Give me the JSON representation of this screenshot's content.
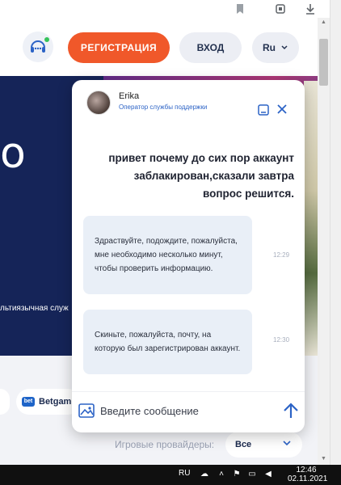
{
  "browser": {
    "icons": [
      "bookmark-icon",
      "extensions-icon",
      "download-icon"
    ]
  },
  "header": {
    "register_label": "РЕГИСТРАЦИЯ",
    "login_label": "ВХОД",
    "language_label": "Ru",
    "accent_color": "#f0582a"
  },
  "hero": {
    "big_text": "о",
    "small_text": "льтиязычная служ"
  },
  "providers": {
    "chip_name": "Betgam",
    "chip_logo_text": "bet",
    "filter_label": "Игровые провайдеры:",
    "filter_value": "Все"
  },
  "chat": {
    "agent": {
      "name": "Erika",
      "role": "Оператор службы поддержки"
    },
    "messages": [
      {
        "from": "user",
        "text": "привет почему до сих пор аккаунт заблакирован,сказали завтра вопрос решится."
      },
      {
        "from": "agent",
        "text": "Здраствуйте, подождите, пожалуйста, мне необходимо несколько минут, чтобы проверить информацию.",
        "time": "12:29"
      },
      {
        "from": "agent",
        "text": "Скиньте, пожалуйста, почту, на которую был зарегистрирован аккаунт.",
        "time": "12:30"
      }
    ],
    "composer_placeholder": "Введите сообщение",
    "accent_color": "#2c63c6"
  },
  "taskbar": {
    "language": "RU",
    "time": "12:46",
    "date": "02.11.2021"
  }
}
